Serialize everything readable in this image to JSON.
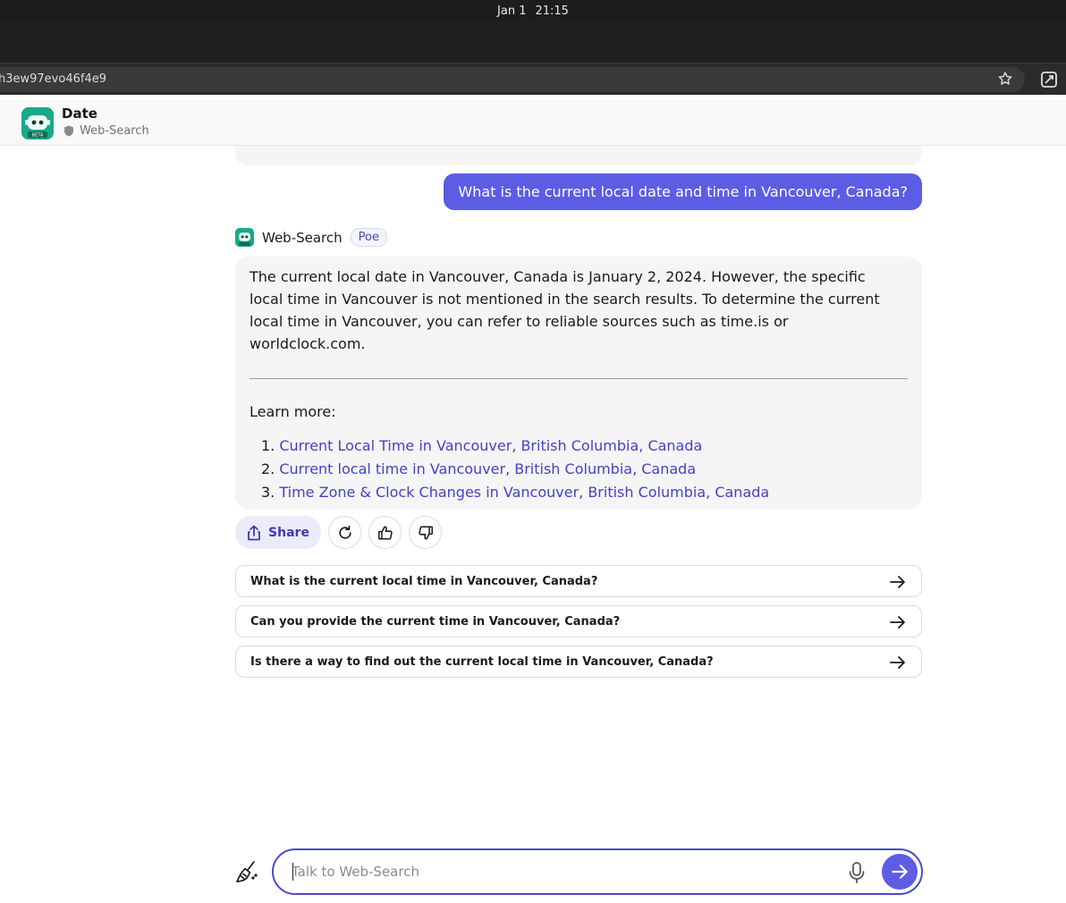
{
  "os": {
    "date": "Jan 1",
    "time": "21:15"
  },
  "browser": {
    "url": "h3ew97evo46f4e9"
  },
  "header": {
    "title": "Date",
    "subtitle": "Web-Search"
  },
  "chat": {
    "user_message": "What is the current local date and time in Vancouver, Canada?",
    "bot_name": "Web-Search",
    "bot_badge": "Poe",
    "bot_answer": "The current local date in Vancouver, Canada is January 2, 2024. However, the specific local time in Vancouver is not mentioned in the search results. To determine the current local time in Vancouver, you can refer to reliable sources such as time.is or worldclock.com.",
    "learn_more_label": "Learn more:",
    "sources": [
      {
        "num": "1.",
        "title": "Current Local Time in Vancouver, British Columbia, Canada"
      },
      {
        "num": "2.",
        "title": "Current local time in Vancouver, British Columbia, Canada"
      },
      {
        "num": "3.",
        "title": "Time Zone & Clock Changes in Vancouver, British Columbia, Canada"
      }
    ]
  },
  "actions": {
    "share_label": "Share"
  },
  "suggestions": [
    "What is the current local time in Vancouver, Canada?",
    "Can you provide the current time in Vancouver, Canada?",
    "Is there a way to find out the current local time in Vancouver, Canada?"
  ],
  "composer": {
    "placeholder": "Talk to Web-Search"
  },
  "colors": {
    "accent": "#5d5ce4",
    "link": "#4442c4",
    "bot_brand": "#1aa88a"
  },
  "icons": {
    "star": "star-icon",
    "share": "share-icon",
    "retry": "refresh-icon",
    "like": "thumbs-up-icon",
    "dislike": "thumbs-down-icon",
    "arrow": "arrow-right-icon",
    "broom": "broom-icon",
    "mic": "microphone-icon",
    "send": "send-icon"
  }
}
